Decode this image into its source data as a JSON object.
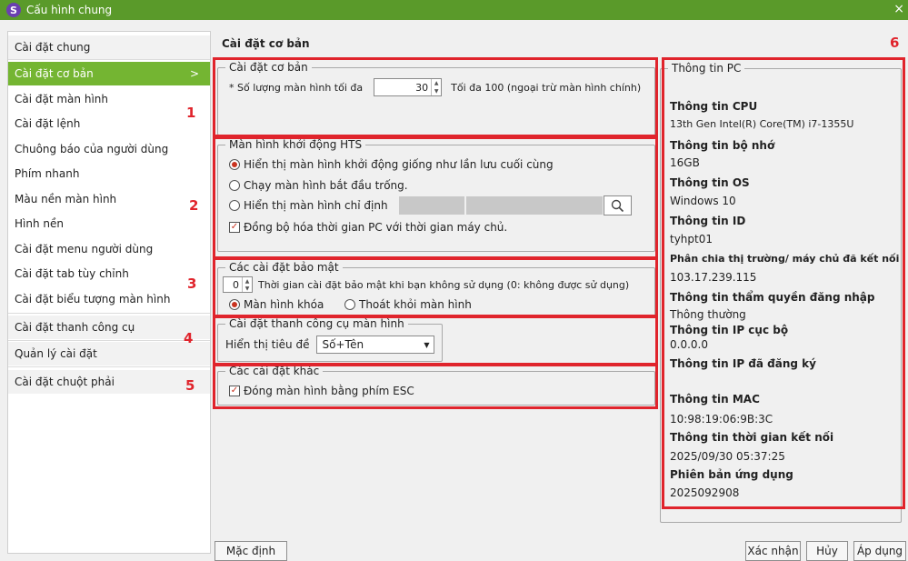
{
  "window": {
    "title": "Cấu hình chung",
    "close": "×"
  },
  "sidebar": {
    "items": [
      {
        "label": "Cài đặt chung"
      },
      {
        "label": "Cài đặt cơ bản",
        "selected": true,
        "chevron": ">"
      },
      {
        "label": "Cài đặt màn hình"
      },
      {
        "label": "Cài đặt lệnh"
      },
      {
        "label": "Chuông báo của người dùng"
      },
      {
        "label": "Phím nhanh"
      },
      {
        "label": "Màu nền màn hình"
      },
      {
        "label": "Hình nền"
      },
      {
        "label": "Cài đặt menu người dùng"
      },
      {
        "label": "Cài đặt tab tùy chỉnh"
      },
      {
        "label": "Cài đặt biểu tượng màn hình"
      },
      {
        "label": "Cài đặt thanh công cụ"
      },
      {
        "label": "Quản lý cài đặt"
      },
      {
        "label": "Cài đặt chuột phải"
      }
    ]
  },
  "main": {
    "title": "Cài đặt cơ bản",
    "basic": {
      "legend": "Cài đặt cơ bản",
      "max_screens_label": "* Số lượng màn hình tối đa",
      "max_screens_value": "30",
      "max_screens_hint": "Tối đa 100 (ngoại trừ màn hình chính)"
    },
    "startup": {
      "legend": "Màn hình khởi động HTS",
      "opt_last": "Hiển thị màn hình khởi động giống như lần lưu cuối cùng",
      "opt_empty": "Chạy màn hình bắt đầu trống.",
      "opt_specific": "Hiển thị màn hình chỉ định",
      "sync_time": "Đồng bộ hóa thời gian PC với thời gian máy chủ."
    },
    "security": {
      "legend": "Các cài đặt bảo mật",
      "timeout_value": "0",
      "timeout_label": "Thời gian cài đặt bảo mật khi bạn không sử dụng (0: không được sử dụng)",
      "opt_lock": "Màn hình khóa",
      "opt_exit": "Thoát khỏi màn hình"
    },
    "toolbar": {
      "legend": "Cài đặt thanh công cụ màn hình",
      "title_label": "Hiển thị tiêu đề",
      "title_value": "Số+Tên"
    },
    "other": {
      "legend": "Các cài đặt khác",
      "esc_close": "Đóng màn hình bằng phím ESC"
    },
    "default_button": "Mặc định"
  },
  "pc_info": {
    "legend": "Thông tin PC",
    "fields": [
      {
        "label": "Thông tin CPU",
        "value": "13th Gen Intel(R) Core(TM) i7-1355U"
      },
      {
        "label": "Thông tin bộ nhớ",
        "value": "16GB"
      },
      {
        "label": "Thông tin OS",
        "value": "Windows 10"
      },
      {
        "label": "Thông tin ID",
        "value": "tyhpt01"
      },
      {
        "label": "Phân chia thị trường/ máy chủ đã kết nối",
        "value": "103.17.239.115"
      },
      {
        "label": "Thông tin thẩm quyền đăng nhập",
        "value": "Thông thường"
      },
      {
        "label": "Thông tin IP cục bộ",
        "value": "0.0.0.0"
      },
      {
        "label": "Thông tin IP đã đăng ký",
        "value": ""
      },
      {
        "label": "Thông tin MAC",
        "value": "10:98:19:06:9B:3C"
      },
      {
        "label": "Thông tin thời gian kết nối",
        "value": "2025/09/30 05:37:25"
      },
      {
        "label": "Phiên bản ứng dụng",
        "value": "2025092908"
      }
    ]
  },
  "footer": {
    "confirm": "Xác nhận",
    "cancel": "Hủy",
    "apply": "Áp dụng"
  },
  "annotations": [
    "1",
    "2",
    "3",
    "4",
    "5",
    "6"
  ],
  "colors": {
    "titlebar": "#5a9a2a",
    "selected": "#74b532",
    "annotation": "#e0242c"
  }
}
